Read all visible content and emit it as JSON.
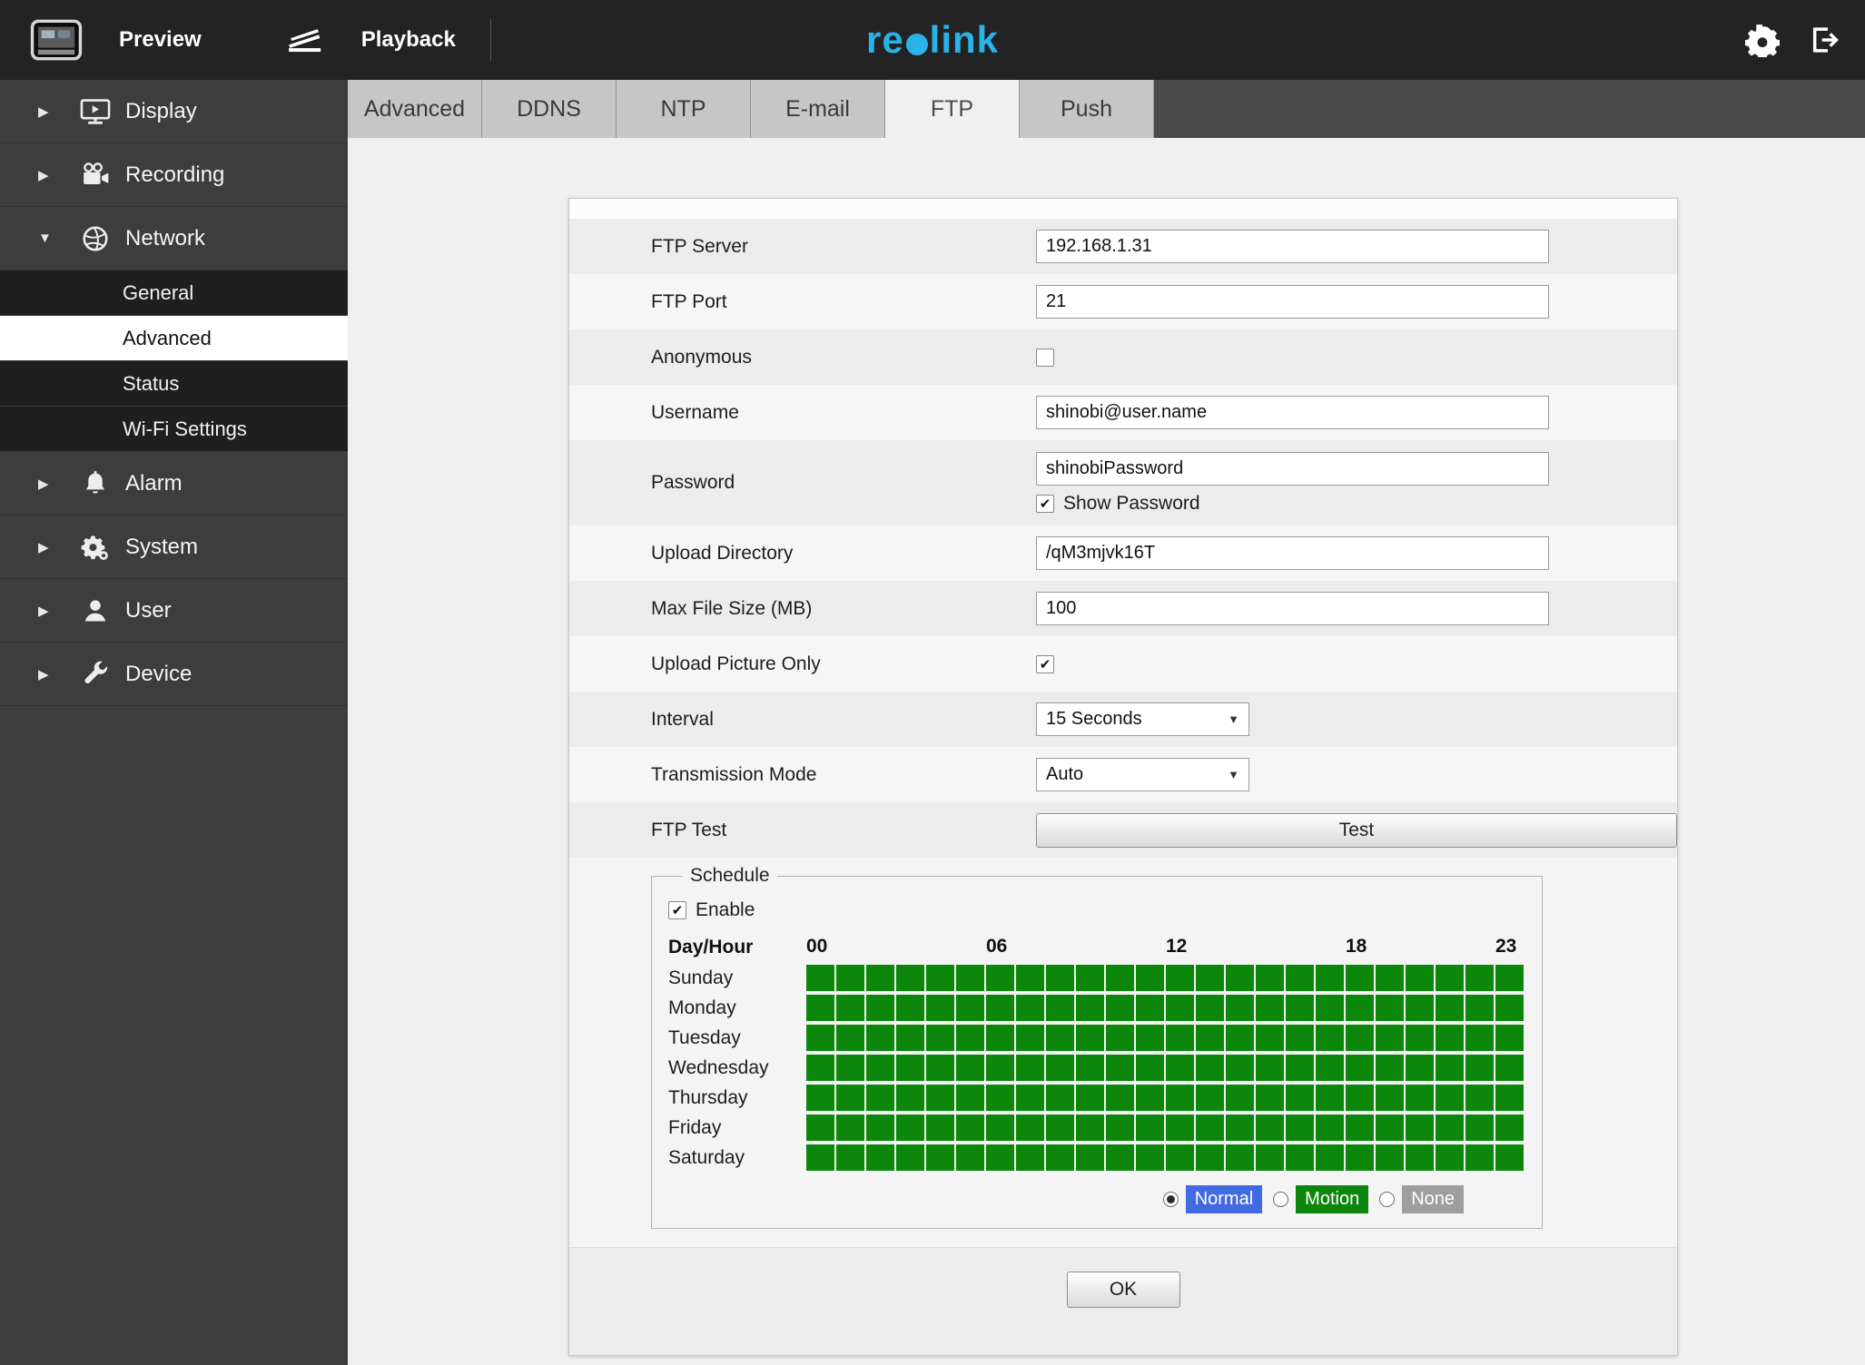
{
  "topbar": {
    "preview": "Preview",
    "playback": "Playback",
    "logo_text": "reolink"
  },
  "colors": {
    "logo": "#29b3e8",
    "schedule_green": "#0c870c",
    "normal_blue": "#4169e1",
    "motion_green": "#0c870c",
    "none_gray": "#9e9e9e"
  },
  "sidebar": {
    "items": [
      {
        "label": "Display",
        "icon": "monitor-icon",
        "expanded": false
      },
      {
        "label": "Recording",
        "icon": "video-camera-icon",
        "expanded": false
      },
      {
        "label": "Network",
        "icon": "globe-icon",
        "expanded": true,
        "children": [
          {
            "label": "General",
            "selected": false
          },
          {
            "label": "Advanced",
            "selected": true
          },
          {
            "label": "Status",
            "selected": false
          },
          {
            "label": "Wi-Fi Settings",
            "selected": false
          }
        ]
      },
      {
        "label": "Alarm",
        "icon": "bell-icon",
        "expanded": false
      },
      {
        "label": "System",
        "icon": "gears-icon",
        "expanded": false
      },
      {
        "label": "User",
        "icon": "user-icon",
        "expanded": false
      },
      {
        "label": "Device",
        "icon": "wrench-icon",
        "expanded": false
      }
    ]
  },
  "tabs": [
    {
      "label": "Advanced",
      "active": false
    },
    {
      "label": "DDNS",
      "active": false
    },
    {
      "label": "NTP",
      "active": false
    },
    {
      "label": "E-mail",
      "active": false
    },
    {
      "label": "FTP",
      "active": true
    },
    {
      "label": "Push",
      "active": false
    }
  ],
  "form": {
    "rows": [
      {
        "type": "text",
        "label": "FTP Server",
        "value": "192.168.1.31"
      },
      {
        "type": "text",
        "label": "FTP Port",
        "value": "21"
      },
      {
        "type": "checkbox",
        "label": "Anonymous",
        "checked": false
      },
      {
        "type": "text",
        "label": "Username",
        "value": "shinobi@user.name"
      },
      {
        "type": "text",
        "label": "Password",
        "value": "shinobiPassword",
        "extra_checkbox": {
          "label": "Show Password",
          "checked": true
        }
      },
      {
        "type": "text",
        "label": "Upload Directory",
        "value": "/qM3mjvk16T"
      },
      {
        "type": "text",
        "label": "Max File Size (MB)",
        "value": "100"
      },
      {
        "type": "checkbox",
        "label": "Upload Picture Only",
        "checked": true
      },
      {
        "type": "select",
        "label": "Interval",
        "value": "15 Seconds"
      },
      {
        "type": "select",
        "label": "Transmission Mode",
        "value": "Auto"
      },
      {
        "type": "button",
        "label": "FTP Test",
        "button_label": "Test"
      }
    ]
  },
  "schedule": {
    "legend": "Schedule",
    "enable_label": "Enable",
    "enable_checked": true,
    "day_hour_label": "Day/Hour",
    "hour_labels": [
      {
        "text": "00",
        "col": 0
      },
      {
        "text": "06",
        "col": 6
      },
      {
        "text": "12",
        "col": 12
      },
      {
        "text": "18",
        "col": 18
      },
      {
        "text": "23",
        "col": 23
      }
    ],
    "days": [
      "Sunday",
      "Monday",
      "Tuesday",
      "Wednesday",
      "Thursday",
      "Friday",
      "Saturday"
    ],
    "columns": 24,
    "all_cells_state": "normal",
    "cell_color": "#0c870c",
    "modes": [
      {
        "label": "Normal",
        "color": "#4169e1",
        "selected": true
      },
      {
        "label": "Motion",
        "color": "#0c870c",
        "selected": false
      },
      {
        "label": "None",
        "color": "#9e9e9e",
        "selected": false
      }
    ]
  },
  "ok_button": "OK"
}
